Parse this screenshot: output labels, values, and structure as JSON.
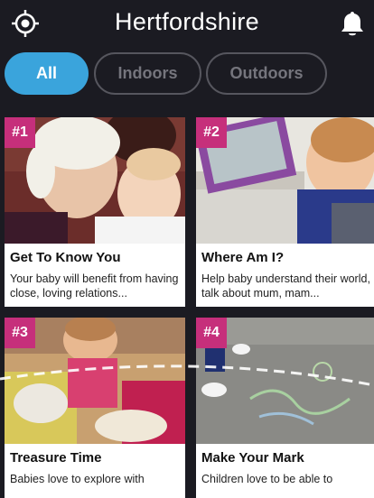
{
  "header": {
    "title": "Hertfordshire",
    "left_icon": "location-crosshair-icon",
    "right_icon": "bell-icon"
  },
  "filters": {
    "tabs": [
      {
        "label": "All",
        "active": true
      },
      {
        "label": "Indoors",
        "active": false
      },
      {
        "label": "Outdoors",
        "active": false
      }
    ]
  },
  "cards": [
    {
      "rank": "#1",
      "title": "Get To Know You",
      "description": "Your baby will benefit from having close, loving relations..."
    },
    {
      "rank": "#2",
      "title": "Where Am I?",
      "description": "Help baby understand their world, talk about  mum, mam..."
    },
    {
      "rank": "#3",
      "title": "Treasure Time",
      "description": "Babies love to explore with"
    },
    {
      "rank": "#4",
      "title": "Make Your Mark",
      "description": "Children love to be able to"
    }
  ],
  "colors": {
    "background": "#1b1b22",
    "accent": "#3aa4dc",
    "rank_badge": "#c62f7b"
  }
}
